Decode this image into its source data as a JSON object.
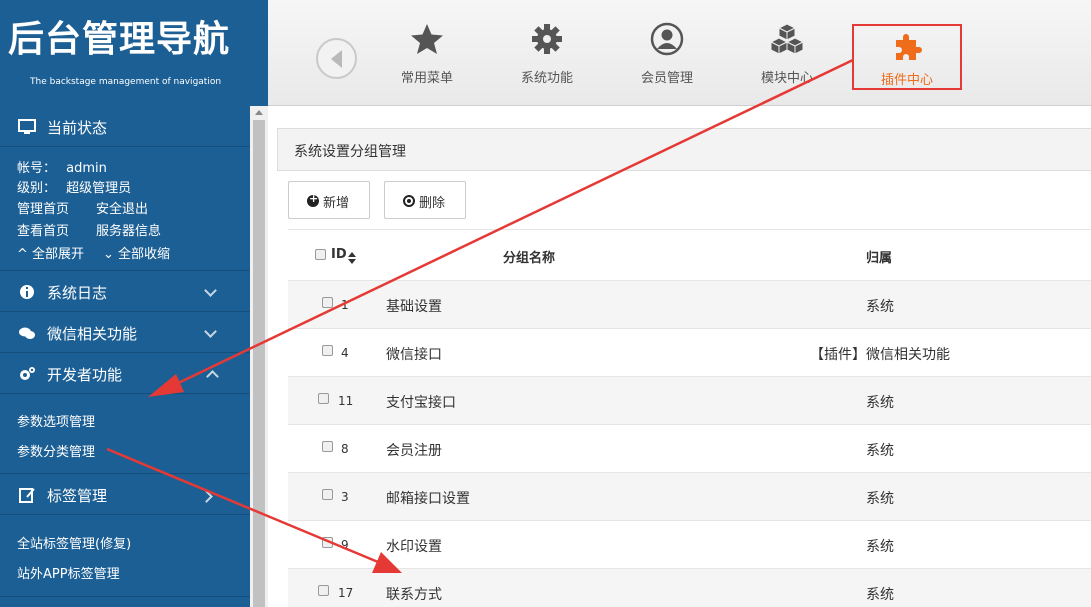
{
  "logo": {
    "title": "后台管理导航",
    "subtitle": "The backstage management of navigation"
  },
  "topnav": {
    "items": [
      {
        "label": "常用菜单",
        "icon": "star-icon"
      },
      {
        "label": "系统功能",
        "icon": "gear-icon"
      },
      {
        "label": "会员管理",
        "icon": "user-icon"
      },
      {
        "label": "模块中心",
        "icon": "cubes-icon"
      },
      {
        "label": "插件中心",
        "icon": "puzzle-icon",
        "highlighted": true
      }
    ]
  },
  "sidebar": {
    "status_title": "当前状态",
    "account_label": "帐号：",
    "account_value": "admin",
    "level_label": "级别：",
    "level_value": "超级管理员",
    "links": [
      "管理首页",
      "安全退出",
      "查看首页",
      "服务器信息"
    ],
    "expand_all": "全部展开",
    "collapse_all": "全部收缩",
    "sections": [
      {
        "label": "系统日志",
        "icon": "info-icon"
      },
      {
        "label": "微信相关功能",
        "icon": "comments-icon"
      },
      {
        "label": "开发者功能",
        "icon": "cogs-icon"
      },
      {
        "label": "标签管理",
        "icon": "edit-icon"
      }
    ],
    "dev_items": [
      "参数选项管理",
      "参数分类管理"
    ],
    "tag_items": [
      "全站标签管理(修复)",
      "站外APP标签管理"
    ]
  },
  "panel": {
    "title": "系统设置分组管理",
    "add_label": "新增",
    "delete_label": "删除"
  },
  "table": {
    "headers": {
      "id": "ID",
      "name": "分组名称",
      "owner": "归属"
    },
    "rows": [
      {
        "id": "1",
        "name": "基础设置",
        "owner": "系统"
      },
      {
        "id": "4",
        "name": "微信接口",
        "owner": "【插件】微信相关功能"
      },
      {
        "id": "11",
        "name": "支付宝接口",
        "owner": "系统"
      },
      {
        "id": "8",
        "name": "会员注册",
        "owner": "系统"
      },
      {
        "id": "3",
        "name": "邮箱接口设置",
        "owner": "系统"
      },
      {
        "id": "9",
        "name": "水印设置",
        "owner": "系统"
      },
      {
        "id": "17",
        "name": "联系方式",
        "owner": "系统"
      }
    ]
  },
  "colors": {
    "brand": "#1c5f94",
    "highlight": "#ef6c1a",
    "annotation": "#e53935"
  }
}
